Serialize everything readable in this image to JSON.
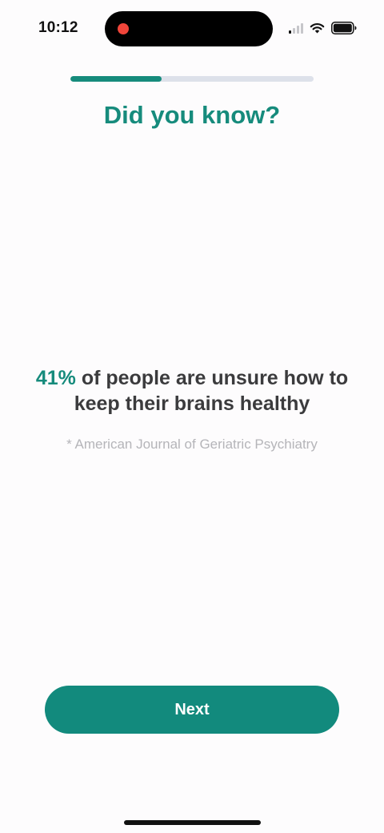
{
  "status_bar": {
    "time": "10:12",
    "icons": [
      "recording-indicator-icon",
      "cellular-signal-icon",
      "wifi-icon",
      "battery-icon"
    ]
  },
  "progress": {
    "fraction": 0.375,
    "color": "#168b7c",
    "track_color": "#dde1ea"
  },
  "title": "Did you know?",
  "fact": {
    "stat": "41%",
    "text": "of people are unsure how to keep their brains healthy"
  },
  "source": "* American Journal of Geriatric Psychiatry",
  "next_button": {
    "label": "Next"
  },
  "colors": {
    "accent": "#168b7c",
    "body_text": "#3b3b3d",
    "muted_text": "#b5b5b9",
    "background": "#fdfcfd"
  }
}
